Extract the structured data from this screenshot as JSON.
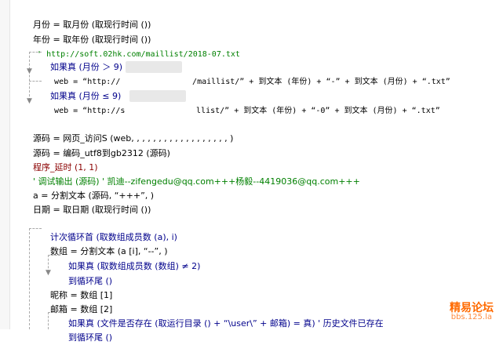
{
  "lines": {
    "l1": "月份 = 取月份 (取现行时间 ())",
    "l2": "年份 = 取年份 (取现行时间 ())",
    "l3": "' http://soft.02hk.com/maillist/2018-07.txt",
    "l4": "如果真 (月份 ＞ 9)",
    "l5a": "web = “http://",
    "l5b": "/maillist/” + 到文本 (年份) + “-” + 到文本 (月份) + “.txt”",
    "l6": "如果真 (月份 ≤ 9)",
    "l7a": "web = “http://s",
    "l7b": "llist/” + 到文本 (年份) + “-0” + 到文本 (月份) + “.txt”",
    "l8": "源码 = 网页_访问S (web, , , , , , , , , , , , , , , , , , )",
    "l9": "源码 = 编码_utf8到gb2312 (源码)",
    "l10": "程序_延时 (1, 1)",
    "l11": "' 调试输出 (源码) ' 凯迪--zifengedu@qq.com+++杨毅--4419036@qq.com+++",
    "l12": "a = 分割文本 (源码, “+++”, )",
    "l13": "日期 = 取日期 (取现行时间 ())",
    "l14": "计次循环首 (取数组成员数 (a), i)",
    "l15": "数组 = 分割文本 (a [i], “--”, )",
    "l16": "如果真 (取数组成员数 (数组) ≠ 2)",
    "l17": "到循环尾 ()",
    "l18": "昵称 = 数组 [1]",
    "l19": "邮箱 = 数组 [2]",
    "l20": "如果真 (文件是否存在 (取运行目录 () + “\\user\\” + 邮箱) = 真) ' 历史文件已存在",
    "l21": "到循环尾 ()"
  },
  "watermark": {
    "title": "精易论坛",
    "url": "bbs.125.la"
  },
  "colors": {
    "keyword": "#00008b",
    "function": "#8b0000",
    "comment": "#008000",
    "watermark": "#ff6a00"
  }
}
